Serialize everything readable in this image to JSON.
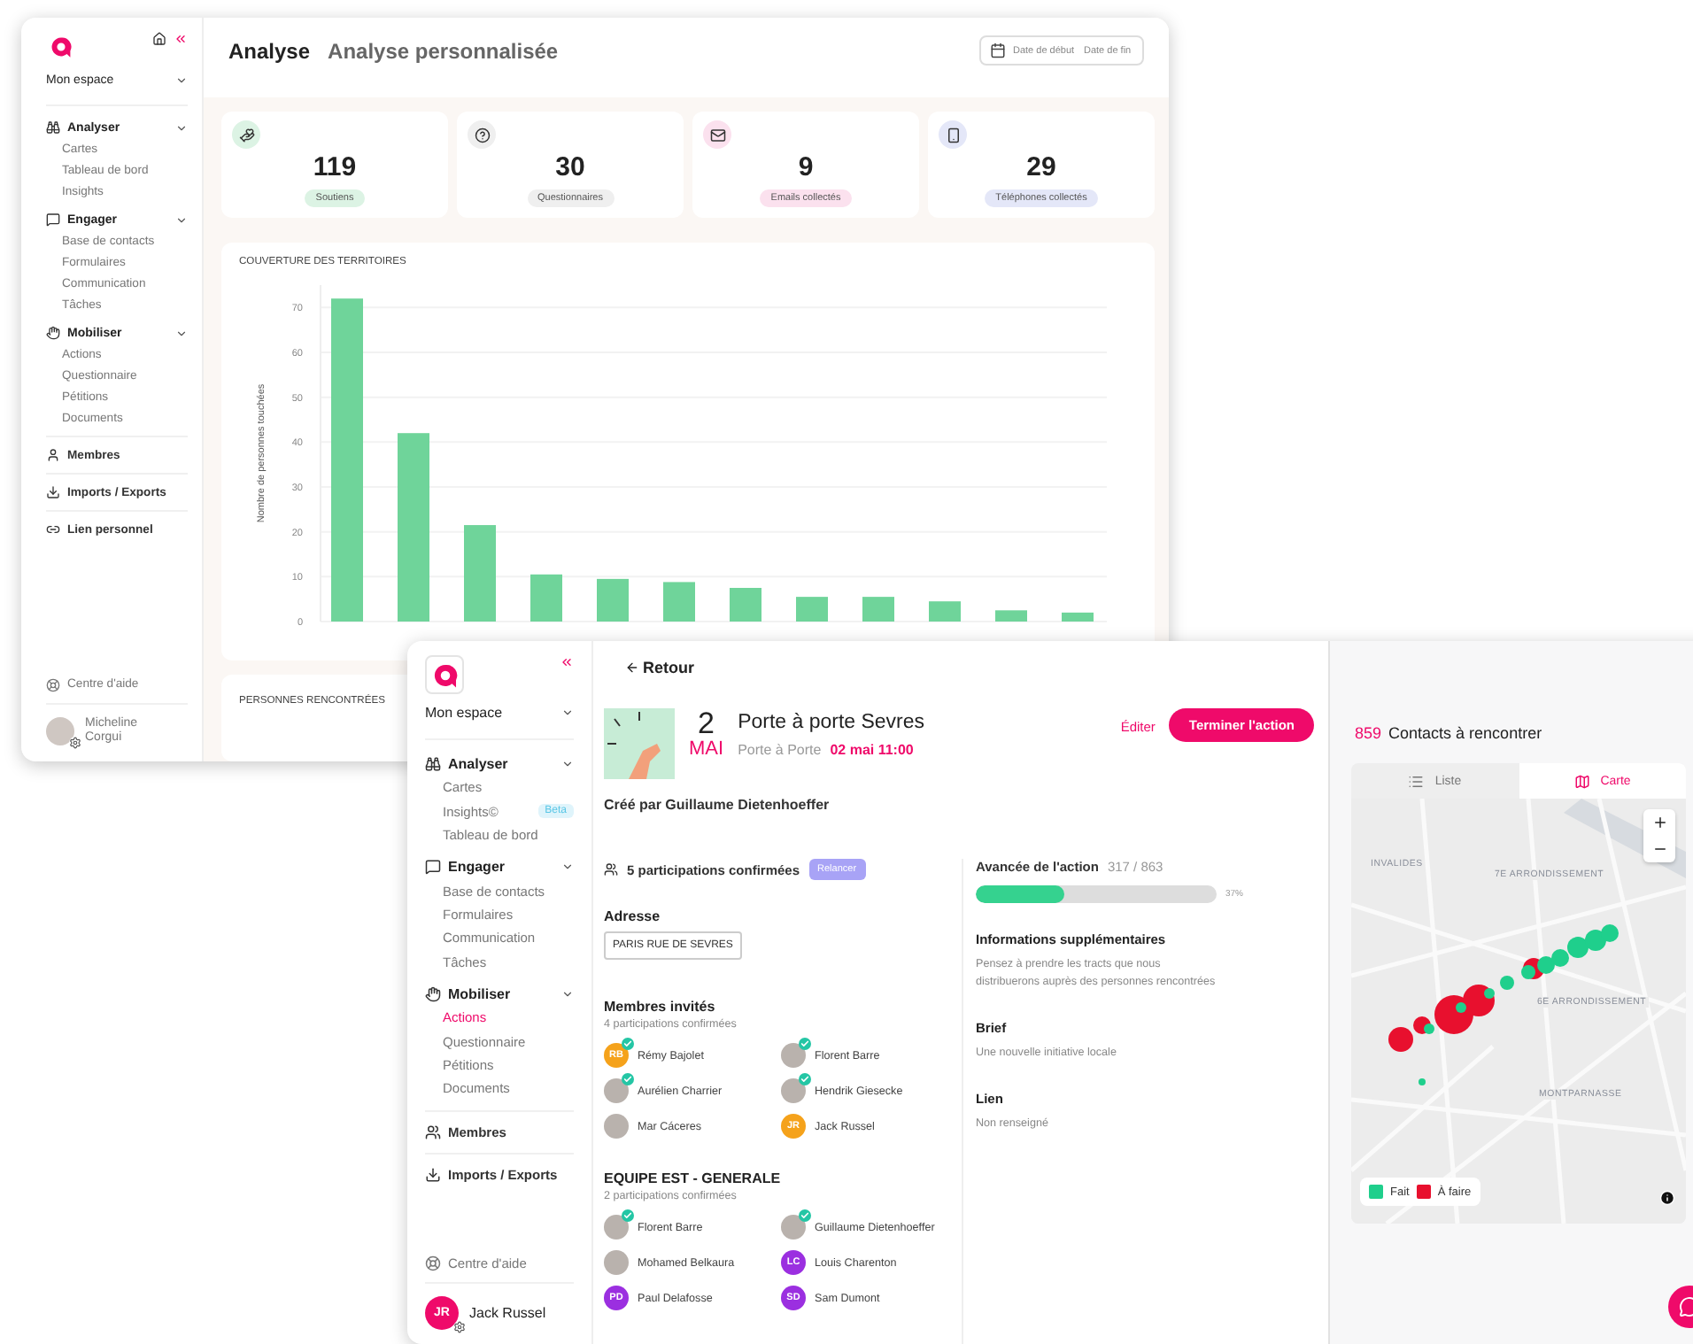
{
  "analytics_window": {
    "sidebar": {
      "home_button": true,
      "workspace": "Mon espace",
      "sections": [
        {
          "label": "Analyser",
          "kind": "binoculars",
          "expanded": true,
          "items": [
            {
              "label": "Cartes",
              "selected": false
            },
            {
              "label": "Tableau de bord",
              "selected": false
            },
            {
              "label": "Insights",
              "selected": false
            }
          ]
        },
        {
          "label": "Engager",
          "kind": "message",
          "expanded": true,
          "items": [
            {
              "label": "Base de contacts",
              "selected": false
            },
            {
              "label": "Formulaires",
              "selected": false
            },
            {
              "label": "Communication",
              "selected": false
            },
            {
              "label": "Tâches",
              "selected": false
            }
          ]
        },
        {
          "label": "Mobiliser",
          "kind": "hand",
          "expanded": true,
          "items": [
            {
              "label": "Actions",
              "selected": false
            },
            {
              "label": "Questionnaire",
              "selected": false
            },
            {
              "label": "Pétitions",
              "selected": false
            },
            {
              "label": "Documents",
              "selected": false
            }
          ]
        }
      ],
      "links": [
        {
          "label": "Membres",
          "kind": "person"
        },
        {
          "label": "Imports / Exports",
          "kind": "download"
        },
        {
          "label": "Lien personnel",
          "kind": "link"
        }
      ],
      "help": "Centre d'aide",
      "user": {
        "name": "Micheline Corgui",
        "kind": "photo"
      }
    },
    "tabs": [
      {
        "label": "Analyse",
        "selected": true
      },
      {
        "label": "Analyse personnalisée",
        "selected": false
      }
    ],
    "date_range": {
      "start_placeholder": "Date de début",
      "end_placeholder": "Date de fin"
    },
    "stats": [
      {
        "value": "119",
        "label": "Soutiens",
        "kind": "support",
        "color": "#dcf3e4"
      },
      {
        "value": "30",
        "label": "Questionnaires",
        "kind": "question",
        "color": "#efefef"
      },
      {
        "value": "9",
        "label": "Emails collectés",
        "kind": "mail",
        "color": "#fbe1ee"
      },
      {
        "value": "29",
        "label": "Téléphones collectés",
        "kind": "phone",
        "color": "#e4e7f8"
      }
    ],
    "coverage": {
      "chart_data": {
        "type": "bar",
        "title": "COUVERTURE DES TERRITOIRES",
        "ylabel": "Nombre de personnes touchées",
        "values": [
          72,
          42,
          21.5,
          10.5,
          9.5,
          8.8,
          7.5,
          5.5,
          5.5,
          4.5,
          2.5,
          2
        ],
        "yticks": [
          0,
          10,
          20,
          30,
          40,
          50,
          60,
          70
        ],
        "ylim": [
          0,
          75
        ],
        "grid": true
      }
    },
    "met_people": {
      "title": "PERSONNES RENCONTRÉES"
    }
  },
  "action_window": {
    "sidebar": {
      "home_button": false,
      "workspace": "Mon espace",
      "sections": [
        {
          "label": "Analyser",
          "kind": "binoculars",
          "expanded": true,
          "items": [
            {
              "label": "Cartes",
              "selected": false
            },
            {
              "label": "Insights©",
              "badge": "Beta",
              "selected": false
            },
            {
              "label": "Tableau de bord",
              "selected": false
            }
          ]
        },
        {
          "label": "Engager",
          "kind": "message",
          "expanded": true,
          "items": [
            {
              "label": "Base de contacts",
              "selected": false
            },
            {
              "label": "Formulaires",
              "selected": false
            },
            {
              "label": "Communication",
              "selected": false
            },
            {
              "label": "Tâches",
              "selected": false
            }
          ]
        },
        {
          "label": "Mobiliser",
          "kind": "hand",
          "expanded": true,
          "items": [
            {
              "label": "Actions",
              "selected": true
            },
            {
              "label": "Questionnaire",
              "selected": false
            },
            {
              "label": "Pétitions",
              "selected": false
            },
            {
              "label": "Documents",
              "selected": false
            }
          ]
        }
      ],
      "links": [
        {
          "label": "Membres",
          "kind": "users"
        },
        {
          "label": "Imports / Exports",
          "kind": "download"
        }
      ],
      "help": "Centre d'aide",
      "user": {
        "name": "Jack Russel",
        "kind": "initials",
        "initials": "JR"
      }
    },
    "back": "Retour",
    "action": {
      "day": "2",
      "month": "MAI",
      "title": "Porte à porte Sevres",
      "type": "Porte à Porte",
      "datetime": "02 mai 11:00",
      "creator": "Créé par Guillaume Dietenhoeffer"
    },
    "edit": "Éditer",
    "finish": "Terminer l'action",
    "participations": "5 participations confirmées",
    "remind": "Relancer",
    "address": {
      "title": "Adresse",
      "value": "PARIS RUE DE SEVRES"
    },
    "groups": [
      {
        "title": "Membres invités",
        "subtitle": "4 participations confirmées",
        "members": [
          {
            "name": "Rémy Bajolet",
            "kind": "initials",
            "initials": "RB",
            "color": "#f5a21b",
            "confirmed": true
          },
          {
            "name": "Florent Barre",
            "kind": "photo",
            "confirmed": true
          },
          {
            "name": "Aurélien Charrier",
            "kind": "photo",
            "confirmed": true
          },
          {
            "name": "Hendrik Giesecke",
            "kind": "photo",
            "confirmed": true
          },
          {
            "name": "Mar Cáceres",
            "kind": "photo",
            "confirmed": false
          },
          {
            "name": "Jack Russel",
            "kind": "initials",
            "initials": "JR",
            "color": "#f5a21b",
            "confirmed": false
          }
        ]
      },
      {
        "title": "EQUIPE EST - GENERALE",
        "subtitle": "2 participations confirmées",
        "members": [
          {
            "name": "Florent Barre",
            "kind": "photo",
            "confirmed": true
          },
          {
            "name": "Guillaume Dietenhoeffer",
            "kind": "photo",
            "confirmed": true
          },
          {
            "name": "Mohamed Belkaura",
            "kind": "photo",
            "confirmed": false
          },
          {
            "name": "Louis Charenton",
            "kind": "initials",
            "initials": "LC",
            "color": "#9b2fe0",
            "confirmed": false
          },
          {
            "name": "Paul Delafosse",
            "kind": "initials",
            "initials": "PD",
            "color": "#9b2fe0",
            "confirmed": false
          },
          {
            "name": "Sam Dumont",
            "kind": "initials",
            "initials": "SD",
            "color": "#9b2fe0",
            "confirmed": false
          }
        ]
      }
    ],
    "progress": {
      "title": "Avancée de l'action",
      "count": "317 / 863",
      "level": 0.37,
      "percent": "37%"
    },
    "details": [
      {
        "title": "Informations supplémentaires",
        "text": "Pensez à prendre les tracts que nous distribuerons auprès des personnes rencontrées"
      },
      {
        "title": "Brief",
        "text": "Une nouvelle initiative locale"
      },
      {
        "title": "Lien",
        "text": "Non renseigné"
      }
    ],
    "contacts": {
      "count": "859",
      "label": "Contacts à rencontrer"
    },
    "view_tabs": [
      {
        "label": "Liste",
        "kind": "list",
        "selected": false
      },
      {
        "label": "Carte",
        "kind": "map",
        "selected": true
      }
    ],
    "map_labels": [
      "INVALIDES",
      "7E ARRONDISSEMENT",
      "6E ARRONDISSEMENT",
      "MONTPARNASSE"
    ],
    "legend": [
      {
        "label": "Fait",
        "color": "#1fcf8c"
      },
      {
        "label": "À faire",
        "color": "#e8102e"
      }
    ]
  }
}
